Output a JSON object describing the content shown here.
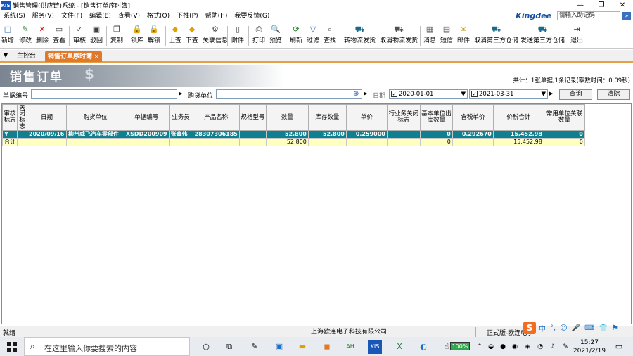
{
  "window": {
    "title": "销售管理(供应链)系统 - [销售订单序时簿]",
    "logo_text": "KIS",
    "minimize": "—",
    "restore": "❐",
    "close": "✕"
  },
  "menu": [
    "系统(S)",
    "服务(V)",
    "文件(F)",
    "编辑(E)",
    "查看(V)",
    "格式(O)",
    "下推(P)",
    "帮助(H)",
    "我要反馈(G)"
  ],
  "kingdee": {
    "brand": "Kingdee",
    "placeholder": "请输入助记码"
  },
  "toolbar": [
    {
      "label": "新增",
      "icon": "new-icon",
      "glyph": "□",
      "color": "#2a5fb0"
    },
    {
      "label": "修改",
      "icon": "edit-icon",
      "glyph": "✎",
      "color": "#2a7a2a"
    },
    {
      "label": "删除",
      "icon": "delete-icon",
      "glyph": "✕",
      "color": "#d02020"
    },
    {
      "label": "查看",
      "icon": "view-icon",
      "glyph": "▭",
      "color": "#404040"
    },
    {
      "label": "审核",
      "icon": "audit-icon",
      "glyph": "✓",
      "color": "#404040"
    },
    {
      "label": "驳回",
      "icon": "reject-icon",
      "glyph": "▣",
      "color": "#404040"
    },
    {
      "label": "复制",
      "icon": "copy-icon",
      "glyph": "❐",
      "color": "#404040"
    },
    {
      "label": "锁库",
      "icon": "lock-icon",
      "glyph": "🔒",
      "color": "#404040"
    },
    {
      "label": "解锁",
      "icon": "unlock-icon",
      "glyph": "🔓",
      "color": "#404040"
    },
    {
      "label": "上查",
      "icon": "trace-up-icon",
      "glyph": "◆",
      "color": "#e0a000"
    },
    {
      "label": "下查",
      "icon": "trace-down-icon",
      "glyph": "◆",
      "color": "#e0a000"
    },
    {
      "label": "关联信息",
      "icon": "related-info-icon",
      "glyph": "⚙",
      "color": "#404040"
    },
    {
      "label": "附件",
      "icon": "attachment-icon",
      "glyph": "▯",
      "color": "#404040"
    },
    {
      "label": "打印",
      "icon": "print-icon",
      "glyph": "⎙",
      "color": "#404040"
    },
    {
      "label": "预览",
      "icon": "preview-icon",
      "glyph": "🔍",
      "color": "#404040"
    },
    {
      "label": "刷新",
      "icon": "refresh-icon",
      "glyph": "⟳",
      "color": "#2a7a2a"
    },
    {
      "label": "过滤",
      "icon": "filter-icon",
      "glyph": "▽",
      "color": "#2a5fb0"
    },
    {
      "label": "查找",
      "icon": "find-icon",
      "glyph": "⌕",
      "color": "#404040"
    },
    {
      "label": "转物流发货",
      "icon": "logistics-ship-icon",
      "glyph": "⛟",
      "color": "#1a6a8a"
    },
    {
      "label": "取消物流发货",
      "icon": "cancel-logistics-icon",
      "glyph": "⛟",
      "color": "#505050"
    },
    {
      "label": "消息",
      "icon": "message-icon",
      "glyph": "▦",
      "color": "#606060"
    },
    {
      "label": "短信",
      "icon": "sms-icon",
      "glyph": "▤",
      "color": "#606060"
    },
    {
      "label": "邮件",
      "icon": "mail-icon",
      "glyph": "✉",
      "color": "#c09000"
    },
    {
      "label": "取消第三方仓储",
      "icon": "cancel-3pl-icon",
      "glyph": "⛟",
      "color": "#1a6a8a"
    },
    {
      "label": "发送第三方仓储",
      "icon": "send-3pl-icon",
      "glyph": "⛟",
      "color": "#1a6a8a"
    },
    {
      "label": "退出",
      "icon": "exit-icon",
      "glyph": "⇥",
      "color": "#404040"
    }
  ],
  "tabs": {
    "home": "主控台",
    "active": "销售订单序时簿",
    "close": "✕"
  },
  "banner": {
    "title": "销售订单",
    "summary": "共计：1张单据,1条记录(取数时间：0.09秒)"
  },
  "filter": {
    "bill_no_label": "单据编号",
    "bill_no_value": "",
    "customer_label": "购货单位",
    "customer_value": "",
    "date_label": "日期",
    "date_from": "2020-01-01",
    "date_to": "2021-03-31",
    "query_button": "查询",
    "clear_button": "清除"
  },
  "grid": {
    "columns": [
      "审核标志",
      "关闭标志",
      "日期",
      "购货单位",
      "单据编号",
      "业务员",
      "产品名称",
      "规格型号",
      "数量",
      "库存数量",
      "单价",
      "行业务关闭标志",
      "基本单位出库数量",
      "含税单价",
      "价税合计",
      "常用单位关联数量"
    ],
    "rows": [
      [
        "Y",
        "",
        "2020/09/16",
        "柳州威飞汽车零部件",
        "XSDD200909",
        "张鑫伟",
        "28307306185",
        "",
        "52,800",
        "52,800",
        "0.259000",
        "",
        "0",
        "0.292670",
        "15,452.98",
        "0"
      ]
    ],
    "total": {
      "label": "合计",
      "quantity": "52,800",
      "base_out": "0",
      "amount": "15,452.98",
      "common_qty": "0"
    }
  },
  "status": {
    "left": "就绪",
    "company": "上海欧连电子科技有限公司",
    "edition": "正式版-欧连电子"
  },
  "ime": [
    "中",
    "°,",
    "☺",
    "🎤",
    "⌨",
    "👕",
    "⚑"
  ],
  "taskbar": {
    "search_placeholder": "在这里输入你要搜索的内容",
    "battery": "100%",
    "time": "15:27",
    "date": "2021/2/19"
  }
}
